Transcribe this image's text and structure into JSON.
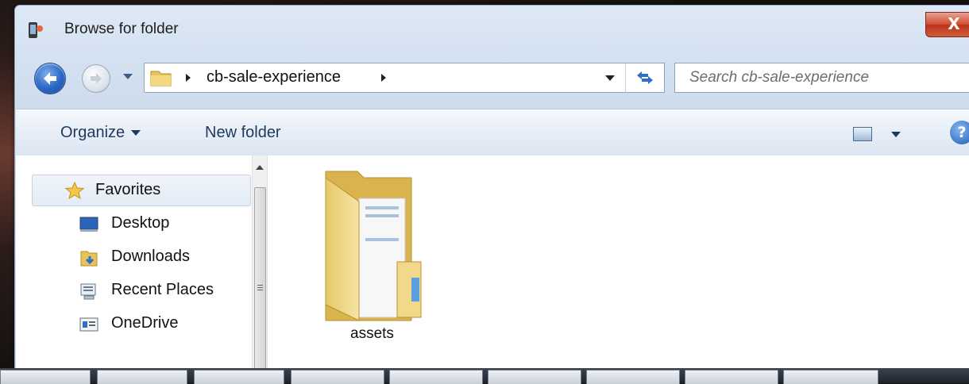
{
  "window": {
    "title": "Browse for folder",
    "close_label": "X"
  },
  "address_bar": {
    "path": [
      "cb-sale-experience"
    ]
  },
  "search": {
    "placeholder": "Search cb-sale-experience"
  },
  "toolbar": {
    "organize_label": "Organize",
    "new_folder_label": "New folder",
    "help_label": "?"
  },
  "navigation": {
    "favorites_label": "Favorites",
    "items": [
      {
        "label": "Desktop",
        "icon": "desktop-icon"
      },
      {
        "label": "Downloads",
        "icon": "downloads-icon"
      },
      {
        "label": "Recent Places",
        "icon": "recent-places-icon"
      },
      {
        "label": "OneDrive",
        "icon": "onedrive-icon"
      }
    ]
  },
  "files": [
    {
      "name": "assets",
      "type": "folder"
    }
  ],
  "colors": {
    "accent": "#1e395b",
    "close": "#cf4b2e"
  }
}
